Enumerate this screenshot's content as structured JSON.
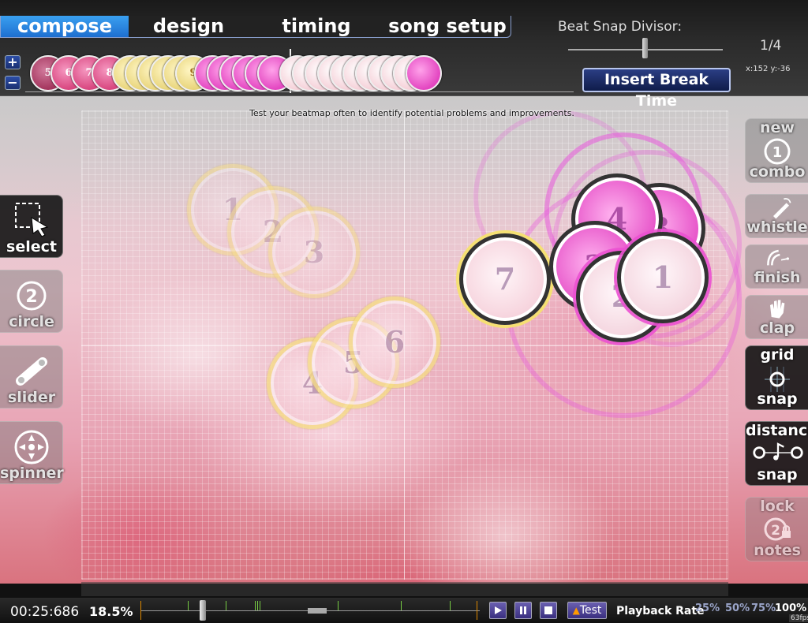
{
  "tabs": [
    {
      "label": "compose",
      "active": true
    },
    {
      "label": "design",
      "active": false
    },
    {
      "label": "timing",
      "active": false
    },
    {
      "label": "song setup",
      "active": false
    }
  ],
  "beat_snap": {
    "label": "Beat Snap Divisor:",
    "value": "1/4",
    "level": 0.5
  },
  "coords_readout": "x:152 y:-36",
  "zoom_buttons": {
    "plus": "+",
    "minus": "−"
  },
  "timeline_notes": [
    {
      "label": "5",
      "color": "maroon"
    },
    {
      "label": "6",
      "color": "red"
    },
    {
      "label": "7",
      "color": "red"
    },
    {
      "label": "8",
      "color": "red"
    },
    {
      "label": "1",
      "color": "yellow"
    },
    {
      "label": "",
      "color": "yellow"
    },
    {
      "label": "",
      "color": "yellow"
    },
    {
      "label": "",
      "color": "yellow"
    },
    {
      "label": "",
      "color": "yellow"
    },
    {
      "label": "9",
      "color": "yellow"
    },
    {
      "label": "",
      "color": "pink"
    },
    {
      "label": "",
      "color": "pink"
    },
    {
      "label": "",
      "color": "pink"
    },
    {
      "label": "",
      "color": "pink"
    },
    {
      "label": "",
      "color": "pink"
    },
    {
      "label": "",
      "color": "pink"
    },
    {
      "label": "",
      "color": "pale"
    },
    {
      "label": "",
      "color": "pale"
    },
    {
      "label": "",
      "color": "pale"
    },
    {
      "label": "",
      "color": "pale"
    },
    {
      "label": "",
      "color": "pale"
    },
    {
      "label": "",
      "color": "pale"
    },
    {
      "label": "",
      "color": "pale"
    },
    {
      "label": "",
      "color": "pale"
    },
    {
      "label": "",
      "color": "pale"
    },
    {
      "label": "",
      "color": "pale"
    },
    {
      "label": "",
      "color": "pink"
    }
  ],
  "insert_break_label": "Insert Break Time",
  "hint": "Test your beatmap often to identify potential problems and improvements.",
  "tools": [
    {
      "label": "select",
      "icon": "select-icon",
      "active": true
    },
    {
      "label": "circle",
      "icon": "circle-icon",
      "active": false
    },
    {
      "label": "slider",
      "icon": "slider-icon",
      "active": false
    },
    {
      "label": "spinner",
      "icon": "spinner-icon",
      "active": false
    }
  ],
  "toggles": {
    "new_combo": {
      "top": "new",
      "bottom": "combo",
      "icon_text": "1"
    },
    "whistle": {
      "label": "whistle"
    },
    "finish": {
      "label": "finish"
    },
    "clap": {
      "label": "clap"
    },
    "grid_snap": {
      "top": "grid",
      "bottom": "snap",
      "active": true
    },
    "distance_snap": {
      "top": "distance",
      "bottom": "snap",
      "active": true
    },
    "lock_notes": {
      "top": "lock",
      "bottom": "notes",
      "icon_text": "2"
    }
  },
  "hit_circles": {
    "c1": "1",
    "c2": "2",
    "c3": "3",
    "c4": "4",
    "c5": "5",
    "c6": "6",
    "c7": "7",
    "m4": "4",
    "m3": "3",
    "m2": "2",
    "m1": "1",
    "mx": "2"
  },
  "bottom": {
    "time": "00:25:686",
    "zoom": "18.5%",
    "test_label": "Test",
    "playback_label": "Playback Rate",
    "rates": [
      "25%",
      "50%",
      "75%",
      "100%"
    ],
    "fps": "63fps"
  },
  "colors": {
    "tab_active": "#1e6fd0",
    "combo_yellow": "#f5de78",
    "combo_magenta": "#e652c8",
    "combo_red": "#d8457e"
  }
}
